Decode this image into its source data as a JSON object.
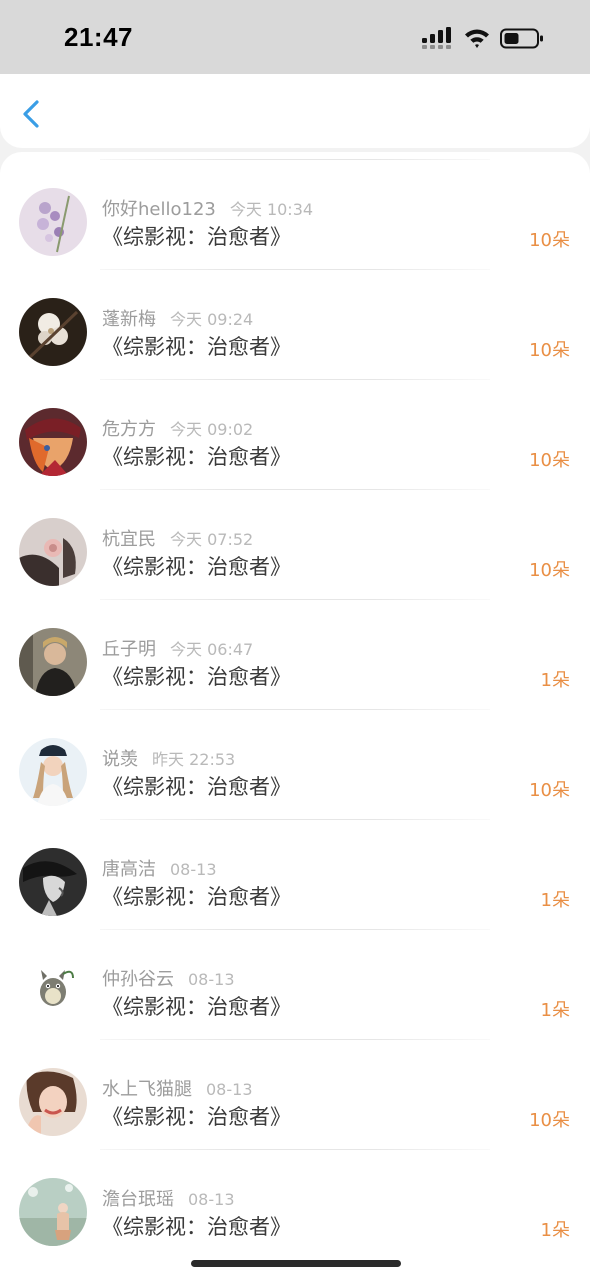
{
  "status_bar": {
    "time": "21:47",
    "icons": [
      "signal-icon",
      "wifi-icon",
      "battery-icon"
    ]
  },
  "nav": {
    "back_icon": "chevron-left-icon"
  },
  "colors": {
    "accent_back": "#3a9ee6",
    "flower_count": "#e98f45",
    "username": "#9c9c9c",
    "timestamp": "#b9b9b9"
  },
  "rows": [
    {
      "user": "你好hello123",
      "time": "今天 10:34",
      "title": "《综影视：治愈者》",
      "count": "10朵"
    },
    {
      "user": "蓬新梅",
      "time": "今天 09:24",
      "title": "《综影视：治愈者》",
      "count": "10朵"
    },
    {
      "user": "危方方",
      "time": "今天 09:02",
      "title": "《综影视：治愈者》",
      "count": "10朵"
    },
    {
      "user": "杭宜民",
      "time": "今天 07:52",
      "title": "《综影视：治愈者》",
      "count": "10朵"
    },
    {
      "user": "丘子明",
      "time": "今天 06:47",
      "title": "《综影视：治愈者》",
      "count": "1朵"
    },
    {
      "user": "说羡",
      "time": "昨天 22:53",
      "title": "《综影视：治愈者》",
      "count": "10朵"
    },
    {
      "user": "唐高洁",
      "time": "08-13",
      "title": "《综影视：治愈者》",
      "count": "1朵"
    },
    {
      "user": "仲孙谷云",
      "time": "08-13",
      "title": "《综影视：治愈者》",
      "count": "1朵"
    },
    {
      "user": "水上飞猫腿",
      "time": "08-13",
      "title": "《综影视：治愈者》",
      "count": "10朵"
    },
    {
      "user": "澹台珉瑶",
      "time": "08-13",
      "title": "《综影视：治愈者》",
      "count": "1朵"
    }
  ]
}
